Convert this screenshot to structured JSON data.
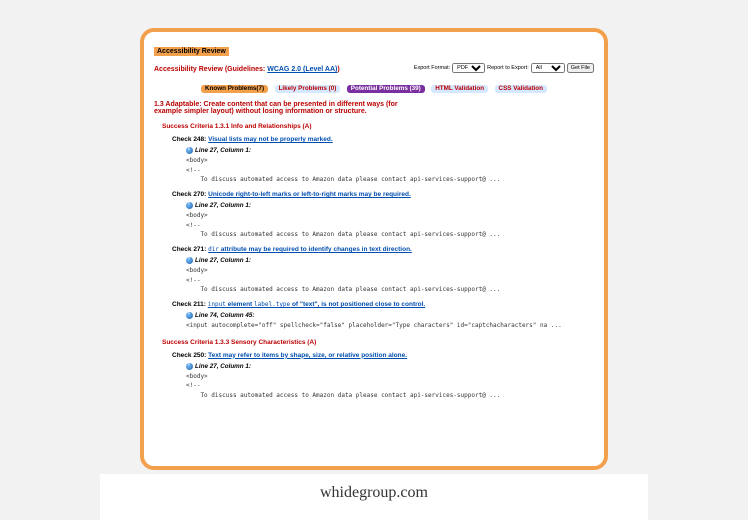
{
  "title_bar": "Accessibility Review",
  "guideline_prefix": "Accessibility Review (Guidelines: ",
  "guideline_link": "WCAG 2.0 (Level AA)",
  "guideline_suffix": ")",
  "export": {
    "format_label": "Export Format:",
    "format_value": "PDF",
    "report_label": "Report to Export:",
    "report_value": "All",
    "button": "Get File"
  },
  "tabs": {
    "known": "Known Problems(7)",
    "likely": "Likely Problems (0)",
    "potential": "Potential Problems (39)",
    "html": "HTML Validation",
    "css": "CSS Validation"
  },
  "section_heading": "1.3 Adaptable: Create content that can be presented in different ways (for example simpler layout) without losing information or structure.",
  "criteria1": "Success Criteria 1.3.1 Info and Relationships (A)",
  "criteria2": "Success Criteria 1.3.3 Sensory Characteristics (A)",
  "checks": {
    "c248": {
      "label": "Check 248:",
      "link": "Visual lists may not be properly marked."
    },
    "c270": {
      "label": "Check 270:",
      "link": "Unicode right-to-left marks or left-to-right marks may be required."
    },
    "c271": {
      "label": "Check 271:",
      "tag": "dir",
      "linktail": " attribute may be required to identify changes in text direction."
    },
    "c211": {
      "label": "Check 211:",
      "tag1": "input",
      "mid": " element ",
      "tag2": "label.type",
      "linktail": " of \"text\", is not positioned close to control."
    },
    "c250": {
      "label": "Check 250:",
      "link": "Text may refer to items by shape, size, or relative position alone."
    }
  },
  "line27": "Line 27, Column 1",
  "line74": "Line 74, Column 45",
  "code_body": "<body>\n<!--\n    To discuss automated access to Amazon data please contact api-services-support@ ...",
  "code_input": "<input autocomplete=\"off\" spellcheck=\"false\" placeholder=\"Type characters\" id=\"captchacharacters\" na ...",
  "watermark": "whidegroup.com"
}
